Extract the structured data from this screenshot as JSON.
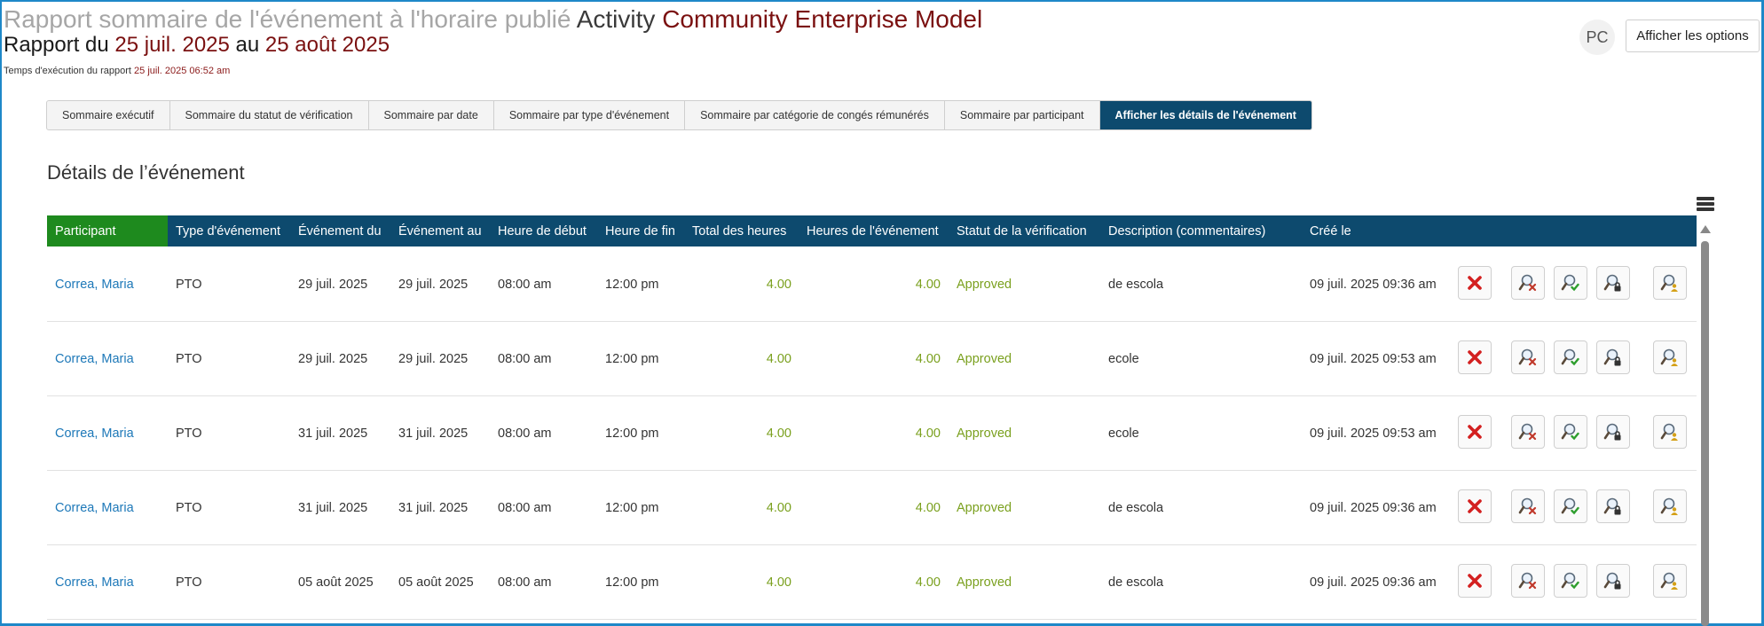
{
  "header": {
    "title_prefix": "Rapport sommaire de l'événement à l'horaire publié",
    "title_activity": "Activity",
    "title_model": "Community Enterprise Model",
    "range_prefix": "Rapport du",
    "range_start": "25 juil. 2025",
    "range_mid": "au",
    "range_end": "25 août 2025",
    "runtime_label": "Temps d'exécution du rapport",
    "runtime_value": "25 juil. 2025 06:52 am"
  },
  "user": {
    "initials": "PC"
  },
  "options_button": "Afficher les options",
  "tabs": [
    {
      "label": "Sommaire exécutif",
      "active": false
    },
    {
      "label": "Sommaire du statut de vérification",
      "active": false
    },
    {
      "label": "Sommaire par date",
      "active": false
    },
    {
      "label": "Sommaire par type d'événement",
      "active": false
    },
    {
      "label": "Sommaire par catégorie de congés rémunérés",
      "active": false
    },
    {
      "label": "Sommaire par participant",
      "active": false
    },
    {
      "label": "Afficher les détails de l'événement",
      "active": true
    }
  ],
  "section_title": "Détails de l’événement",
  "table": {
    "columns": [
      "Participant",
      "Type d'événement",
      "Événement du",
      "Événement au",
      "Heure de début",
      "Heure de fin",
      "Total des heures",
      "Heures de l'événement",
      "Statut de la vérification",
      "Description (commentaires)",
      "Créé le"
    ],
    "rows": [
      {
        "participant": "Correa, Maria",
        "type": "PTO",
        "from": "29 juil. 2025",
        "to": "29 juil. 2025",
        "start": "08:00 am",
        "end": "12:00 pm",
        "total": "4.00",
        "hours": "4.00",
        "status": "Approved",
        "description": "de escola",
        "created": "09 juil. 2025 09:36 am"
      },
      {
        "participant": "Correa, Maria",
        "type": "PTO",
        "from": "29 juil. 2025",
        "to": "29 juil. 2025",
        "start": "08:00 am",
        "end": "12:00 pm",
        "total": "4.00",
        "hours": "4.00",
        "status": "Approved",
        "description": "ecole",
        "created": "09 juil. 2025 09:53 am"
      },
      {
        "participant": "Correa, Maria",
        "type": "PTO",
        "from": "31 juil. 2025",
        "to": "31 juil. 2025",
        "start": "08:00 am",
        "end": "12:00 pm",
        "total": "4.00",
        "hours": "4.00",
        "status": "Approved",
        "description": "ecole",
        "created": "09 juil. 2025 09:53 am"
      },
      {
        "participant": "Correa, Maria",
        "type": "PTO",
        "from": "31 juil. 2025",
        "to": "31 juil. 2025",
        "start": "08:00 am",
        "end": "12:00 pm",
        "total": "4.00",
        "hours": "4.00",
        "status": "Approved",
        "description": "de escola",
        "created": "09 juil. 2025 09:36 am"
      },
      {
        "participant": "Correa, Maria",
        "type": "PTO",
        "from": "05 août 2025",
        "to": "05 août 2025",
        "start": "08:00 am",
        "end": "12:00 pm",
        "total": "4.00",
        "hours": "4.00",
        "status": "Approved",
        "description": "de escola",
        "created": "09 juil. 2025 09:36 am"
      }
    ]
  },
  "row_actions": [
    "delete-icon",
    "search-reject-icon",
    "search-approve-icon",
    "search-lock-icon",
    "search-user-icon"
  ],
  "colors": {
    "header_bar": "#0d4a6e",
    "participant_header": "#1e8a1e",
    "link": "#1d78b8",
    "approved": "#7aa01e",
    "accent_red": "#7a1010"
  }
}
